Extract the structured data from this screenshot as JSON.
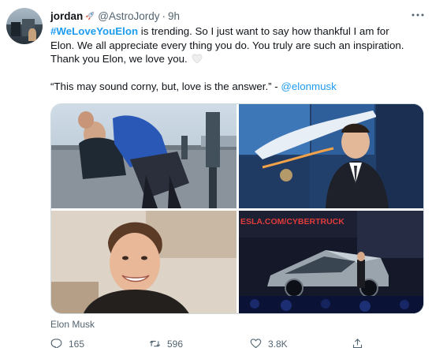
{
  "tweet": {
    "author_name": "jordan",
    "author_emoji": "rocket-emoji",
    "handle": "@AstroJordy",
    "separator": "·",
    "time": "9h",
    "body": {
      "hashtag": "#WeLoveYouElon",
      "line1_rest": " is trending. So I just want to say how thankful I am for",
      "line2": "Elon. We all appreciate every thing you do. You truly are such an inspiration.",
      "line3": "Thank you Elon, we love you.",
      "line3_emoji": "white-heart-emoji",
      "quote": "“This may sound corny, but, love is the answer.” - ",
      "mention": "@elonmusk"
    },
    "media_alt": "Elon Musk",
    "media_count": 4,
    "banner_text": "ESLA.COM/CYBERTRUCK",
    "actions": {
      "reply_count": "165",
      "retweet_count": "596",
      "like_count": "3.8K"
    }
  },
  "colors": {
    "text": "#0f1419",
    "secondary": "#536471",
    "accent": "#1d9bf0",
    "border": "#cfd9de"
  }
}
